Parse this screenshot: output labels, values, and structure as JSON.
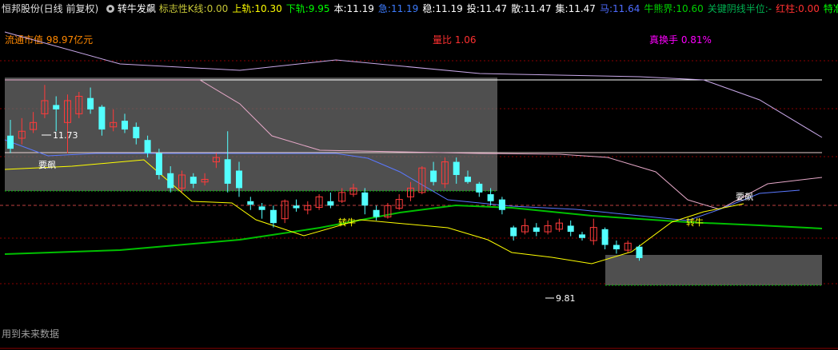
{
  "header": {
    "title": "恒邦股份(日线 前复权)",
    "gear_icon": "gear-icon",
    "indicator_name": "转牛发飙",
    "fields": [
      {
        "label": "标志性K线:",
        "value": "0.00",
        "color": "#c6c637"
      },
      {
        "label": "上轨:",
        "value": "10.30",
        "color": "#ffff00"
      },
      {
        "label": "下轨:",
        "value": "9.95",
        "color": "#00ff00"
      },
      {
        "label": "本:",
        "value": "11.19",
        "color": "#ffffff"
      },
      {
        "label": "急:",
        "value": "11.19",
        "color": "#3d7cff"
      },
      {
        "label": "稳:",
        "value": "11.19",
        "color": "#ffffff"
      },
      {
        "label": "投:",
        "value": "11.47",
        "color": "#ffffff"
      },
      {
        "label": "散:",
        "value": "11.47",
        "color": "#ffffff"
      },
      {
        "label": "集:",
        "value": "11.47",
        "color": "#ffffff"
      },
      {
        "label": "马:",
        "value": "11.64",
        "color": "#4e6cff"
      },
      {
        "label": "牛熊界:",
        "value": "10.60",
        "color": "#00d000"
      },
      {
        "label": "关键阴线半位:",
        "value": "-",
        "color": "#00b050"
      },
      {
        "label": "红柱:",
        "value": "0.00",
        "color": "#ff3030"
      },
      {
        "label": "特准抄",
        "value": "",
        "color": "#00ff00"
      }
    ]
  },
  "info": {
    "market_cap": "流通市值 98.97亿元",
    "volume_ratio": "量比 1.06",
    "turnover": "真换手 0.81%"
  },
  "footer": {
    "note": "用到未来数据"
  },
  "chart_data": {
    "type": "candlestick",
    "ylim": [
      9.0,
      12.5
    ],
    "high_label": "11.73",
    "low_label": "9.81",
    "signals": [
      {
        "text": "要飙",
        "index": 3
      },
      {
        "text": "转牛",
        "index": 27
      },
      {
        "text": "转牛",
        "index": 56
      },
      {
        "text": "要飙",
        "index": 60
      }
    ],
    "candles": [
      [
        11.15,
        11.0,
        11.33,
        10.95
      ],
      [
        11.12,
        11.2,
        11.35,
        11.05
      ],
      [
        11.22,
        11.3,
        11.42,
        11.18
      ],
      [
        11.4,
        11.55,
        11.73,
        11.35
      ],
      [
        11.5,
        11.45,
        11.6,
        11.2
      ],
      [
        11.3,
        11.55,
        11.62,
        10.95
      ],
      [
        11.4,
        11.6,
        11.65,
        11.35
      ],
      [
        11.58,
        11.45,
        11.7,
        11.4
      ],
      [
        11.48,
        11.22,
        11.5,
        11.15
      ],
      [
        11.25,
        11.3,
        11.45,
        11.2
      ],
      [
        11.32,
        11.22,
        11.4,
        11.18
      ],
      [
        11.25,
        11.12,
        11.3,
        11.05
      ],
      [
        11.1,
        10.95,
        11.15,
        10.9
      ],
      [
        10.95,
        10.7,
        11.0,
        10.65
      ],
      [
        10.72,
        10.55,
        10.8,
        10.5
      ],
      [
        10.55,
        10.7,
        10.75,
        10.5
      ],
      [
        10.68,
        10.6,
        10.72,
        10.55
      ],
      [
        10.62,
        10.65,
        10.72,
        10.58
      ],
      [
        10.85,
        10.9,
        10.95,
        10.78
      ],
      [
        10.88,
        10.6,
        11.2,
        10.5
      ],
      [
        10.75,
        10.55,
        10.85,
        10.45
      ],
      [
        10.4,
        10.36,
        10.45,
        10.3
      ],
      [
        10.34,
        10.3,
        10.38,
        10.2
      ],
      [
        10.3,
        10.15,
        10.35,
        10.1
      ],
      [
        10.2,
        10.4,
        10.42,
        10.15
      ],
      [
        10.35,
        10.32,
        10.42,
        10.28
      ],
      [
        10.3,
        10.35,
        10.4,
        10.25
      ],
      [
        10.33,
        10.45,
        10.48,
        10.3
      ],
      [
        10.4,
        10.35,
        10.5,
        10.32
      ],
      [
        10.4,
        10.5,
        10.55,
        10.38
      ],
      [
        10.48,
        10.55,
        10.6,
        10.45
      ],
      [
        10.5,
        10.35,
        10.55,
        10.25
      ],
      [
        10.3,
        10.22,
        10.35,
        10.18
      ],
      [
        10.22,
        10.35,
        10.38,
        10.2
      ],
      [
        10.32,
        10.42,
        10.48,
        10.3
      ],
      [
        10.45,
        10.55,
        10.62,
        10.4
      ],
      [
        10.5,
        10.78,
        10.8,
        10.48
      ],
      [
        10.75,
        10.62,
        10.85,
        10.58
      ],
      [
        10.6,
        10.85,
        10.9,
        10.55
      ],
      [
        10.85,
        10.7,
        10.9,
        10.6
      ],
      [
        10.68,
        10.62,
        10.75,
        10.6
      ],
      [
        10.6,
        10.5,
        10.62,
        10.45
      ],
      [
        10.48,
        10.4,
        10.55,
        10.35
      ],
      [
        10.42,
        10.3,
        10.45,
        10.25
      ],
      [
        10.1,
        10.0,
        10.12,
        9.95
      ],
      [
        10.05,
        10.12,
        10.2,
        10.02
      ],
      [
        10.1,
        10.05,
        10.15,
        10.0
      ],
      [
        10.05,
        10.12,
        10.18,
        10.02
      ],
      [
        10.08,
        10.15,
        10.2,
        10.05
      ],
      [
        10.12,
        10.05,
        10.18,
        10.0
      ],
      [
        10.02,
        9.98,
        10.05,
        9.95
      ],
      [
        9.95,
        10.1,
        10.2,
        9.9
      ],
      [
        10.08,
        9.9,
        10.1,
        9.85
      ],
      [
        9.9,
        9.85,
        9.95,
        9.8
      ],
      [
        9.84,
        9.92,
        9.95,
        9.81
      ],
      [
        9.88,
        9.75,
        9.9,
        9.72
      ]
    ]
  },
  "legend_colors": {
    "up": "#ff3b3b",
    "down": "#53ffff",
    "grid": "#8b0000",
    "zone": "#6a6a6a",
    "bull_bear": "#00c000",
    "upper_band": "#ffff00",
    "line_blue": "#5a78ff",
    "line_pink": "#e6a8c8",
    "line_lavender": "#c8a8e8"
  }
}
